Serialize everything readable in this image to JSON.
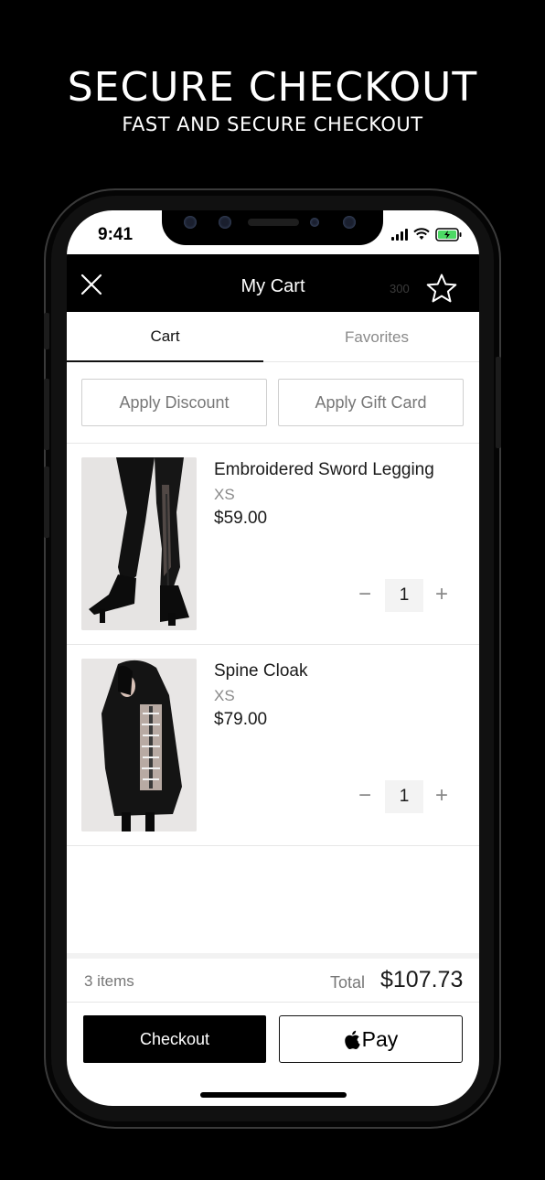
{
  "promo": {
    "title": "SECURE CHECKOUT",
    "subtitle": "FAST AND SECURE CHECKOUT"
  },
  "status_bar": {
    "time": "9:41"
  },
  "header": {
    "title": "My Cart",
    "count": "300"
  },
  "tabs": [
    {
      "label": "Cart",
      "active": true
    },
    {
      "label": "Favorites",
      "active": false
    }
  ],
  "actions": {
    "discount_label": "Apply Discount",
    "gift_card_label": "Apply Gift Card"
  },
  "cart_items": [
    {
      "name": "Embroidered Sword Legging",
      "size": "XS",
      "price": "$59.00",
      "quantity": "1",
      "minus": "−",
      "plus": "+"
    },
    {
      "name": "Spine Cloak",
      "size": "XS",
      "price": "$79.00",
      "quantity": "1",
      "minus": "−",
      "plus": "+"
    }
  ],
  "summary": {
    "items_count": "3 items",
    "total_label": "Total",
    "total_value": "$107.73"
  },
  "buttons": {
    "checkout_label": "Checkout",
    "pay_label": "Pay"
  },
  "colors": {
    "header_bg": "#000000",
    "battery": "#4cd964"
  },
  "icons": {
    "close": "close-icon",
    "favorite": "star-icon",
    "apple": "apple-icon"
  }
}
